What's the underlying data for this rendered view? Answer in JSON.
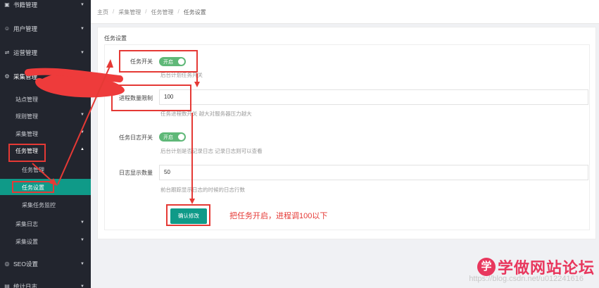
{
  "sidebar": {
    "items": [
      {
        "label": "书籍管理"
      },
      {
        "label": "用户管理"
      },
      {
        "label": "运营管理"
      },
      {
        "label": "采集管理"
      },
      {
        "label": "站点管理"
      },
      {
        "label": "规则管理"
      },
      {
        "label": "采集管理"
      },
      {
        "label": "任务管理"
      },
      {
        "label": "任务管理"
      },
      {
        "label": "任务设置"
      },
      {
        "label": "采集任务监控"
      },
      {
        "label": "采集日志"
      },
      {
        "label": "采集设置"
      },
      {
        "label": "SEO设置"
      },
      {
        "label": "统计日志"
      }
    ]
  },
  "breadcrumb": {
    "home": "主页",
    "level1": "采集管理",
    "level2": "任务管理",
    "current": "任务设置"
  },
  "card": {
    "title": "任务设置",
    "task_switch": {
      "label": "任务开关",
      "toggle_text": "开启",
      "hint": "后台计划任务开关"
    },
    "thread_limit": {
      "label": "进程数量限制",
      "value": "100",
      "hint": "任务进程数开关 越大对服务器压力越大"
    },
    "log_switch": {
      "label": "任务日志开关",
      "toggle_text": "开启",
      "hint": "后台计划是否记录日志 记录日志则可以查看"
    },
    "log_count": {
      "label": "日志显示数量",
      "value": "50",
      "hint": "前台跟踪显示日志的时候的日志行数"
    },
    "confirm_label": "确认修改"
  },
  "annotation_note": "把任务开启，进程调100以下",
  "watermark": {
    "logo_char": "学",
    "site_name": "学做网站论坛",
    "url": "https://blog.csdn.net/u012241616"
  },
  "colors": {
    "sidebar_bg": "#22252e",
    "accent": "#0f9a88",
    "toggle_on": "#5fb878",
    "annotation_red": "#e53935",
    "watermark": "#e8375d"
  }
}
